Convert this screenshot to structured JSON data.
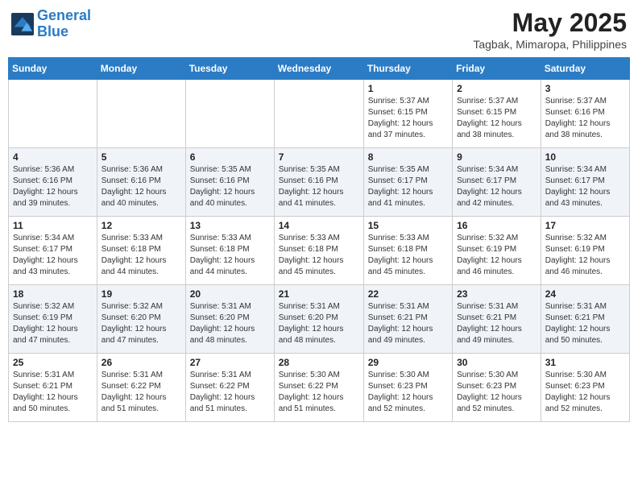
{
  "header": {
    "logo_line1": "General",
    "logo_line2": "Blue",
    "month_year": "May 2025",
    "location": "Tagbak, Mimaropa, Philippines"
  },
  "days_of_week": [
    "Sunday",
    "Monday",
    "Tuesday",
    "Wednesday",
    "Thursday",
    "Friday",
    "Saturday"
  ],
  "weeks": [
    [
      {
        "day": "",
        "info": ""
      },
      {
        "day": "",
        "info": ""
      },
      {
        "day": "",
        "info": ""
      },
      {
        "day": "",
        "info": ""
      },
      {
        "day": "1",
        "info": "Sunrise: 5:37 AM\nSunset: 6:15 PM\nDaylight: 12 hours\nand 37 minutes."
      },
      {
        "day": "2",
        "info": "Sunrise: 5:37 AM\nSunset: 6:15 PM\nDaylight: 12 hours\nand 38 minutes."
      },
      {
        "day": "3",
        "info": "Sunrise: 5:37 AM\nSunset: 6:16 PM\nDaylight: 12 hours\nand 38 minutes."
      }
    ],
    [
      {
        "day": "4",
        "info": "Sunrise: 5:36 AM\nSunset: 6:16 PM\nDaylight: 12 hours\nand 39 minutes."
      },
      {
        "day": "5",
        "info": "Sunrise: 5:36 AM\nSunset: 6:16 PM\nDaylight: 12 hours\nand 40 minutes."
      },
      {
        "day": "6",
        "info": "Sunrise: 5:35 AM\nSunset: 6:16 PM\nDaylight: 12 hours\nand 40 minutes."
      },
      {
        "day": "7",
        "info": "Sunrise: 5:35 AM\nSunset: 6:16 PM\nDaylight: 12 hours\nand 41 minutes."
      },
      {
        "day": "8",
        "info": "Sunrise: 5:35 AM\nSunset: 6:17 PM\nDaylight: 12 hours\nand 41 minutes."
      },
      {
        "day": "9",
        "info": "Sunrise: 5:34 AM\nSunset: 6:17 PM\nDaylight: 12 hours\nand 42 minutes."
      },
      {
        "day": "10",
        "info": "Sunrise: 5:34 AM\nSunset: 6:17 PM\nDaylight: 12 hours\nand 43 minutes."
      }
    ],
    [
      {
        "day": "11",
        "info": "Sunrise: 5:34 AM\nSunset: 6:17 PM\nDaylight: 12 hours\nand 43 minutes."
      },
      {
        "day": "12",
        "info": "Sunrise: 5:33 AM\nSunset: 6:18 PM\nDaylight: 12 hours\nand 44 minutes."
      },
      {
        "day": "13",
        "info": "Sunrise: 5:33 AM\nSunset: 6:18 PM\nDaylight: 12 hours\nand 44 minutes."
      },
      {
        "day": "14",
        "info": "Sunrise: 5:33 AM\nSunset: 6:18 PM\nDaylight: 12 hours\nand 45 minutes."
      },
      {
        "day": "15",
        "info": "Sunrise: 5:33 AM\nSunset: 6:18 PM\nDaylight: 12 hours\nand 45 minutes."
      },
      {
        "day": "16",
        "info": "Sunrise: 5:32 AM\nSunset: 6:19 PM\nDaylight: 12 hours\nand 46 minutes."
      },
      {
        "day": "17",
        "info": "Sunrise: 5:32 AM\nSunset: 6:19 PM\nDaylight: 12 hours\nand 46 minutes."
      }
    ],
    [
      {
        "day": "18",
        "info": "Sunrise: 5:32 AM\nSunset: 6:19 PM\nDaylight: 12 hours\nand 47 minutes."
      },
      {
        "day": "19",
        "info": "Sunrise: 5:32 AM\nSunset: 6:20 PM\nDaylight: 12 hours\nand 47 minutes."
      },
      {
        "day": "20",
        "info": "Sunrise: 5:31 AM\nSunset: 6:20 PM\nDaylight: 12 hours\nand 48 minutes."
      },
      {
        "day": "21",
        "info": "Sunrise: 5:31 AM\nSunset: 6:20 PM\nDaylight: 12 hours\nand 48 minutes."
      },
      {
        "day": "22",
        "info": "Sunrise: 5:31 AM\nSunset: 6:21 PM\nDaylight: 12 hours\nand 49 minutes."
      },
      {
        "day": "23",
        "info": "Sunrise: 5:31 AM\nSunset: 6:21 PM\nDaylight: 12 hours\nand 49 minutes."
      },
      {
        "day": "24",
        "info": "Sunrise: 5:31 AM\nSunset: 6:21 PM\nDaylight: 12 hours\nand 50 minutes."
      }
    ],
    [
      {
        "day": "25",
        "info": "Sunrise: 5:31 AM\nSunset: 6:21 PM\nDaylight: 12 hours\nand 50 minutes."
      },
      {
        "day": "26",
        "info": "Sunrise: 5:31 AM\nSunset: 6:22 PM\nDaylight: 12 hours\nand 51 minutes."
      },
      {
        "day": "27",
        "info": "Sunrise: 5:31 AM\nSunset: 6:22 PM\nDaylight: 12 hours\nand 51 minutes."
      },
      {
        "day": "28",
        "info": "Sunrise: 5:30 AM\nSunset: 6:22 PM\nDaylight: 12 hours\nand 51 minutes."
      },
      {
        "day": "29",
        "info": "Sunrise: 5:30 AM\nSunset: 6:23 PM\nDaylight: 12 hours\nand 52 minutes."
      },
      {
        "day": "30",
        "info": "Sunrise: 5:30 AM\nSunset: 6:23 PM\nDaylight: 12 hours\nand 52 minutes."
      },
      {
        "day": "31",
        "info": "Sunrise: 5:30 AM\nSunset: 6:23 PM\nDaylight: 12 hours\nand 52 minutes."
      }
    ]
  ]
}
